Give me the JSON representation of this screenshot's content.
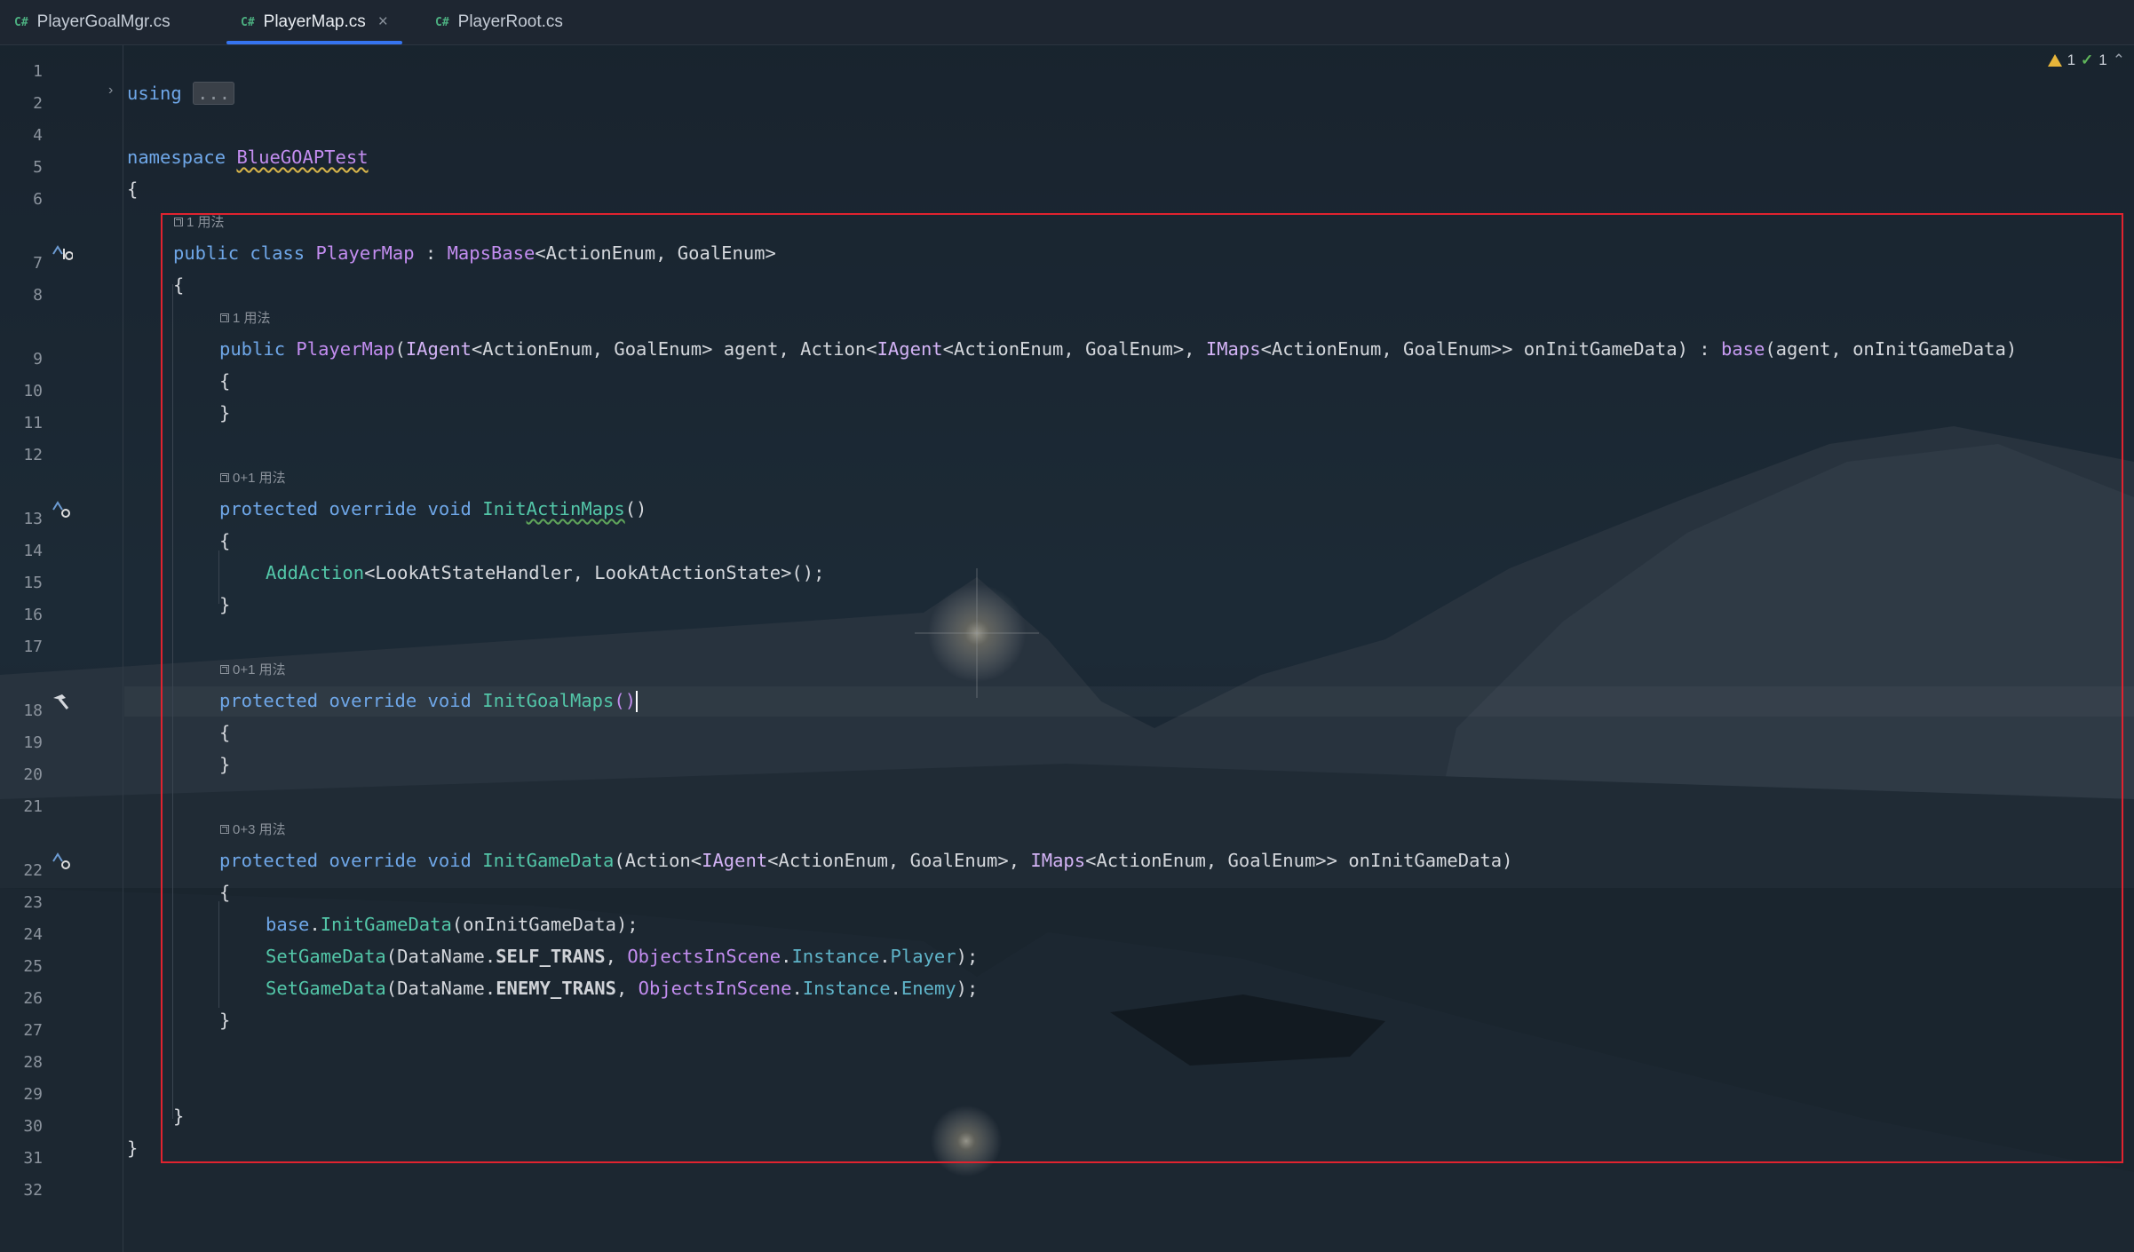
{
  "tabs": [
    {
      "lang": "C#",
      "label": "PlayerGoalMgr.cs",
      "active": false
    },
    {
      "lang": "C#",
      "label": "PlayerMap.cs",
      "active": true,
      "close": "×"
    },
    {
      "lang": "C#",
      "label": "PlayerRoot.cs",
      "active": false
    }
  ],
  "inspections": {
    "warnings": "1",
    "ok": "1",
    "collapse_icon": "chevron-up-icon"
  },
  "line_numbers": [
    "1",
    "2",
    "4",
    "5",
    "6",
    "7",
    "8",
    "9",
    "10",
    "11",
    "12",
    "13",
    "14",
    "15",
    "16",
    "17",
    "18",
    "19",
    "20",
    "21",
    "22",
    "23",
    "24",
    "25",
    "26",
    "27",
    "28",
    "29",
    "30",
    "31",
    "32"
  ],
  "hints": {
    "class_usage": "1 用法",
    "ctor_usage": "1 用法",
    "initactin_usage": "0+1 用法",
    "initgoal_usage": "0+1 用法",
    "initgame_usage": "0+3 用法"
  },
  "code": {
    "using_kw": "using",
    "using_fold": "...",
    "namespace_kw": "namespace",
    "namespace_name": "BlueGOAPTest",
    "brace_open": "{",
    "brace_close": "}",
    "class_line": {
      "public": "public",
      "class": "class",
      "name": "PlayerMap",
      "colon": " : ",
      "base": "MapsBase",
      "generic": "<ActionEnum, GoalEnum>"
    },
    "ctor_line": {
      "public": "public",
      "name": "PlayerMap",
      "p1": "(",
      "t1": "IAgent",
      "g1": "<ActionEnum, GoalEnum> agent, ",
      "t2": "Action",
      "lt": "<",
      "t3": "IAgent",
      "g2": "<ActionEnum, GoalEnum>, ",
      "t4": "IMaps",
      "g3": "<ActionEnum, GoalEnum>> onInitGameData) : ",
      "base": "base",
      "rest": "(agent, onInitGameData)"
    },
    "protected": "protected",
    "override": "override",
    "void": "void",
    "m1_name_a": "Init",
    "m1_name_b": "ActinMaps",
    "parens": "()",
    "add_action": "AddAction",
    "add_action_args": "<LookAtStateHandler, LookAtActionState>();",
    "m2_name": "InitGoalMaps",
    "m3_name": "InitGameData",
    "m3_p_open": "(",
    "m3_action": "Action",
    "m3_lt": "<",
    "m3_iagent": "IAgent",
    "m3_g1": "<ActionEnum, GoalEnum>, ",
    "m3_imaps": "IMaps",
    "m3_g2": "<ActionEnum, GoalEnum>> onInitGameData)",
    "body1_base": "base",
    "body1_dot": ".",
    "body1_fn": "InitGameData",
    "body1_rest": "(onInitGameData);",
    "set_fn": "SetGameData",
    "p_open": "(",
    "dataname": "DataName",
    "dot": ".",
    "self_trans": "SELF_TRANS",
    "enemy_trans": "ENEMY_TRANS",
    "comma": ", ",
    "objects": "ObjectsInScene",
    "instance": "Instance",
    "player": "Player",
    "enemy": "Enemy",
    "end": ");"
  },
  "colors": {
    "accent": "#3574f0",
    "highlight_box": "#e0232f"
  }
}
